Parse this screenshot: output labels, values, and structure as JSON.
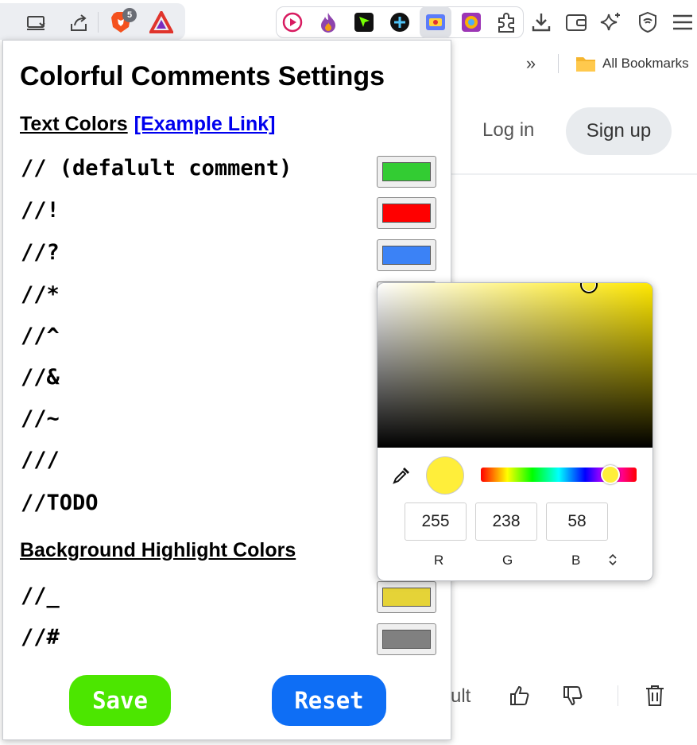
{
  "browser": {
    "brave_badge": "5",
    "bookmarks_label": "All Bookmarks"
  },
  "page": {
    "login": "Log in",
    "signup": "Sign up",
    "partial_text": "ult"
  },
  "popup": {
    "title": "Colorful Comments Settings",
    "text_colors_heading": "Text Colors",
    "example_link": "[Example Link]",
    "text_rows": [
      {
        "label": "// (defalult comment)",
        "color": "#33cc33"
      },
      {
        "label": "//!",
        "color": "#ff0000"
      },
      {
        "label": "//?",
        "color": "#3b82f6"
      },
      {
        "label": "//*",
        "color": "#ff3ff3"
      },
      {
        "label": "//^",
        "color": "#ff9900"
      },
      {
        "label": "//&",
        "color": "#ff5900"
      },
      {
        "label": "//~",
        "color": "#bd4bd9"
      },
      {
        "label": "///",
        "color": "#555555"
      },
      {
        "label": "//TODO",
        "color": "#ff8c00"
      }
    ],
    "bg_heading": "Background Highlight Colors",
    "bg_rows": [
      {
        "label": "//_",
        "color": "#e5d337"
      },
      {
        "label": "//#",
        "color": "#808080"
      }
    ],
    "save_label": "Save",
    "reset_label": "Reset",
    "save_color": "#4ce600",
    "reset_color": "#0e6ef5"
  },
  "picker": {
    "r": "255",
    "g": "238",
    "b": "58",
    "r_label": "R",
    "g_label": "G",
    "b_label": "B",
    "preview_color": "#ffee3a"
  }
}
